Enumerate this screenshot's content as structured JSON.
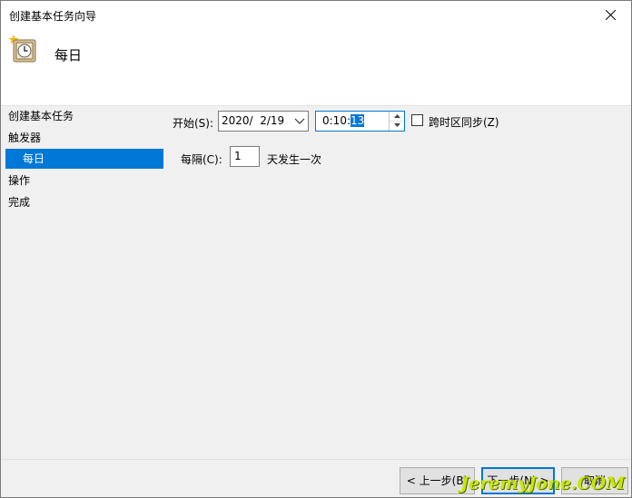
{
  "window": {
    "title": "创建基本任务向导"
  },
  "header": {
    "title": "每日",
    "icon": "clock-task-icon"
  },
  "sidebar": {
    "items": [
      {
        "label": "创建基本任务",
        "selected": false
      },
      {
        "label": "触发器",
        "selected": false
      },
      {
        "label": "每日",
        "selected": true
      },
      {
        "label": "操作",
        "selected": false
      },
      {
        "label": "完成",
        "selected": false
      }
    ]
  },
  "form": {
    "start_label": "开始(S):",
    "date_value": "2020/  2/19",
    "time_value_prefix": "0:10:",
    "time_value_selected": "13",
    "sync_timezone_label": "跨时区同步(Z)",
    "sync_timezone_checked": false,
    "recur_label": "每隔(C):",
    "recur_value": "1",
    "recur_suffix": "天发生一次"
  },
  "buttons": {
    "back": "< 上一步(B)",
    "next": "下一步(N) >",
    "cancel": "取消"
  },
  "watermark": "JeremyJone.COM",
  "colors": {
    "accent": "#0078d7",
    "watermark": "#c8e800"
  }
}
